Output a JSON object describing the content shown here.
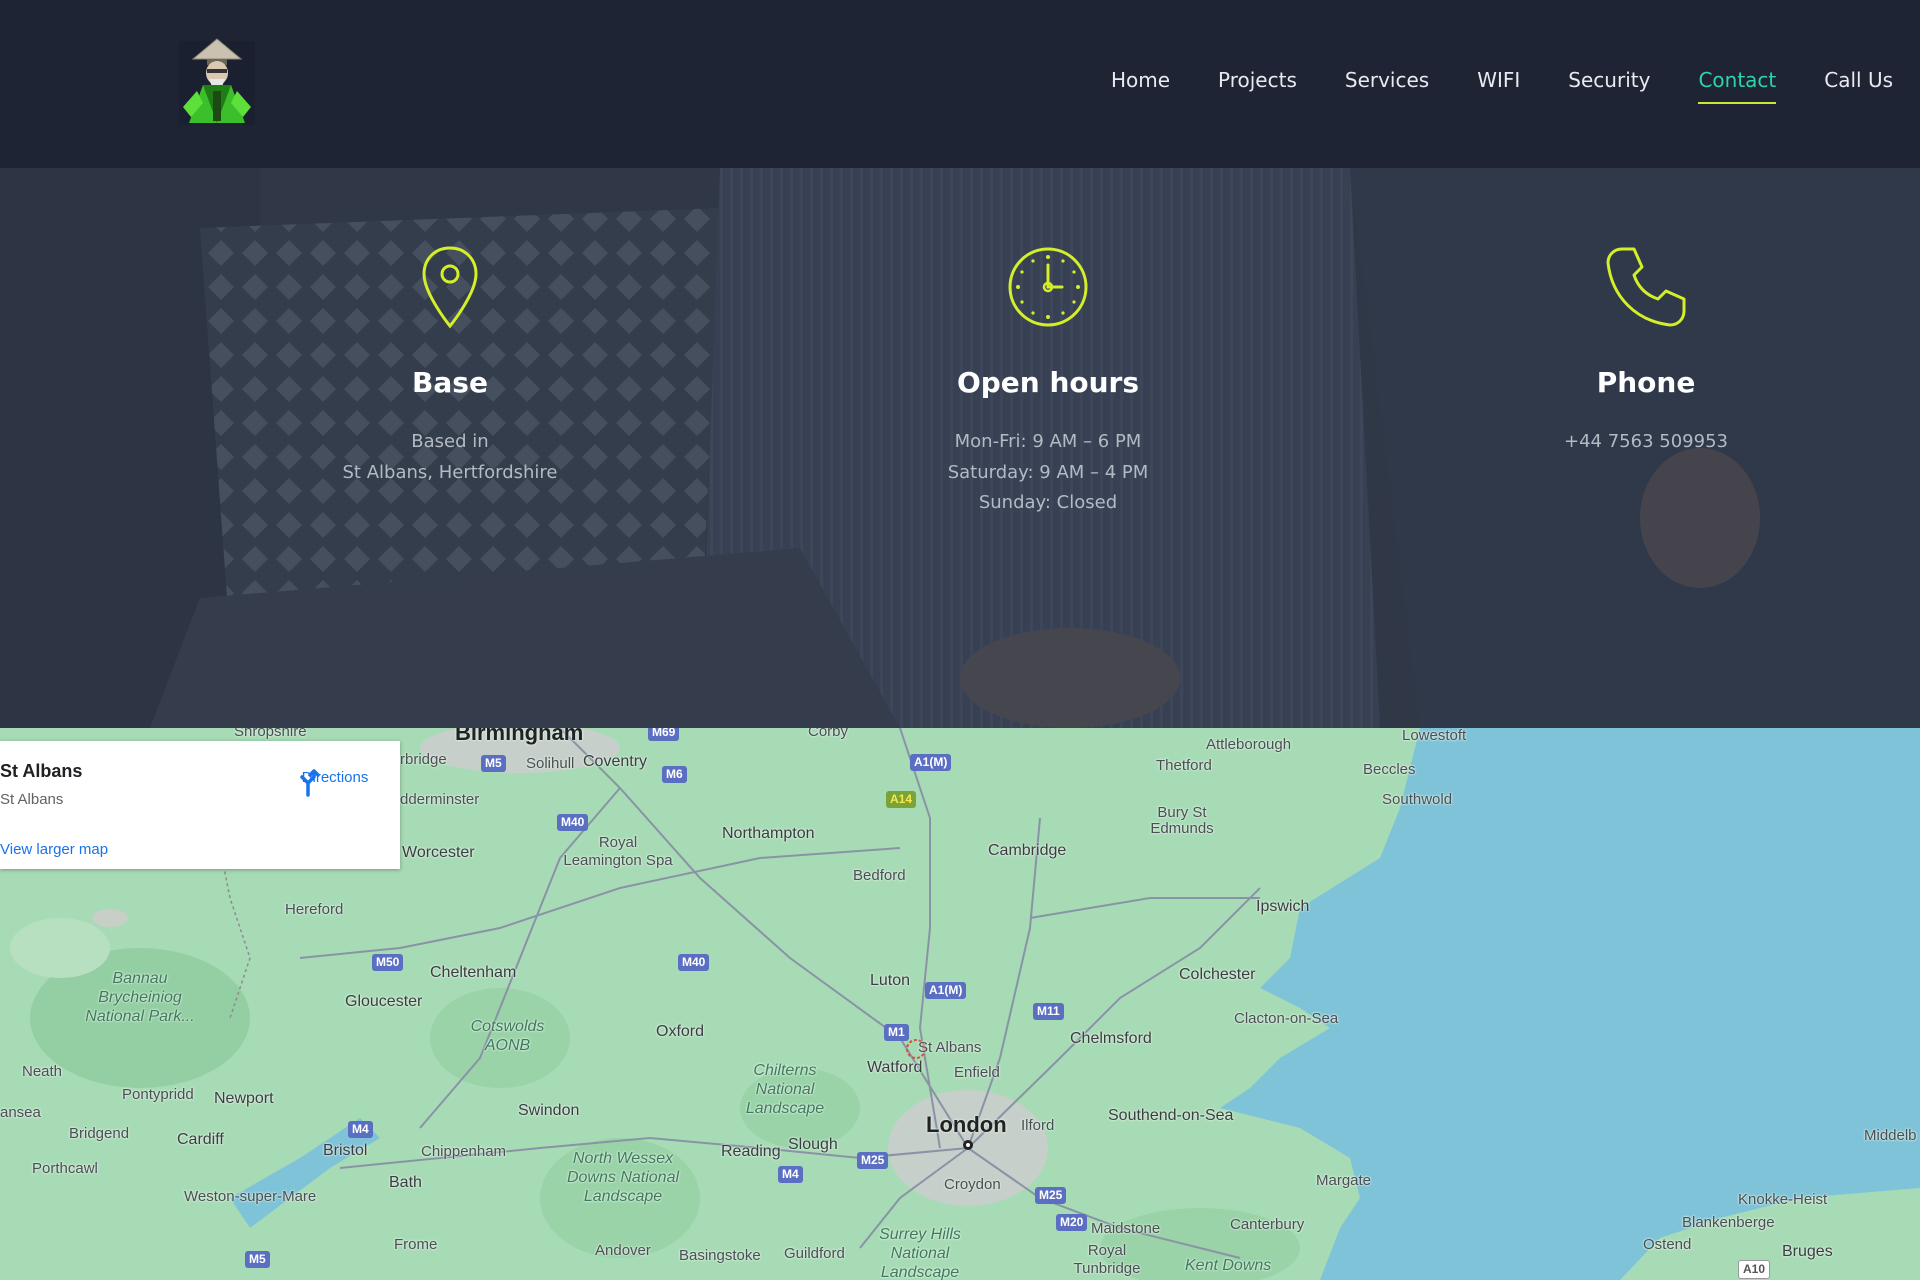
{
  "header": {
    "logo_icon": "ninja-mascot-logo",
    "nav": [
      {
        "label": "Home",
        "active": false
      },
      {
        "label": "Projects",
        "active": false
      },
      {
        "label": "Services",
        "active": false
      },
      {
        "label": "WIFI",
        "active": false
      },
      {
        "label": "Security",
        "active": false
      },
      {
        "label": "Contact",
        "active": true
      },
      {
        "label": "Call Us",
        "active": false
      }
    ]
  },
  "info": {
    "base": {
      "icon": "map-pin-icon",
      "title": "Base",
      "lines": [
        "Based in",
        "St Albans, Hertfordshire"
      ]
    },
    "hours": {
      "icon": "clock-icon",
      "title": "Open hours",
      "lines": [
        "Mon-Fri: 9 AM – 6 PM",
        "Saturday: 9 AM – 4 PM",
        "Sunday: Closed"
      ]
    },
    "phone": {
      "icon": "phone-icon",
      "title": "Phone",
      "lines": [
        "+44 7563 509953"
      ]
    }
  },
  "map": {
    "card": {
      "place": "St Albans",
      "address": "St Albans",
      "directions": "Directions",
      "larger_map": "View larger map"
    },
    "labels": {
      "london": "London",
      "birmingham": "Birmingham",
      "cities": [
        "Coventry",
        "Northampton",
        "Cambridge",
        "Ipswich",
        "Colchester",
        "Chelmsford",
        "Oxford",
        "Luton",
        "Watford",
        "Reading",
        "Slough",
        "Swindon",
        "Bristol",
        "Cardiff",
        "Newport",
        "Gloucester",
        "Cheltenham",
        "Worcester",
        "Southend-on-Sea",
        "Bedford"
      ],
      "towns": [
        "Shropshire",
        "Solihull",
        "Corby",
        "Attleborough",
        "Lowestoft",
        "Thetford",
        "Beccles",
        "Southwold",
        "Bury St Edmunds",
        "Royal Leamington Spa",
        "Hereford",
        "Enfield",
        "Ilford",
        "Clacton-on-Sea",
        "Croydon",
        "Margate",
        "Canterbury",
        "Maidstone",
        "Royal Tunbridge",
        "Bath",
        "Chippenham",
        "Frome",
        "Andover",
        "Basingstoke",
        "Guildford",
        "Weston-super-Mare",
        "Neath",
        "Pontypridd",
        "Bridgend",
        "Porthcawl",
        "Knokke-Heist",
        "Blankenberge",
        "Ostend",
        "Bruges",
        "Middelb",
        "ansea",
        "rbridge",
        "dderminster",
        "St Albans"
      ],
      "parks": [
        "Bannau Brycheiniog National Park...",
        "Cotswolds AONB",
        "Chilterns National Landscape",
        "North Wessex Downs National Landscape",
        "Surrey Hills National Landscape",
        "Kent Downs"
      ],
      "roads": [
        "M69",
        "M5",
        "M6",
        "M40",
        "A1(M)",
        "A14",
        "M50",
        "M40",
        "A1(M)",
        "M11",
        "M1",
        "M4",
        "M25",
        "M4",
        "M25",
        "M20",
        "M5",
        "A10"
      ]
    }
  }
}
